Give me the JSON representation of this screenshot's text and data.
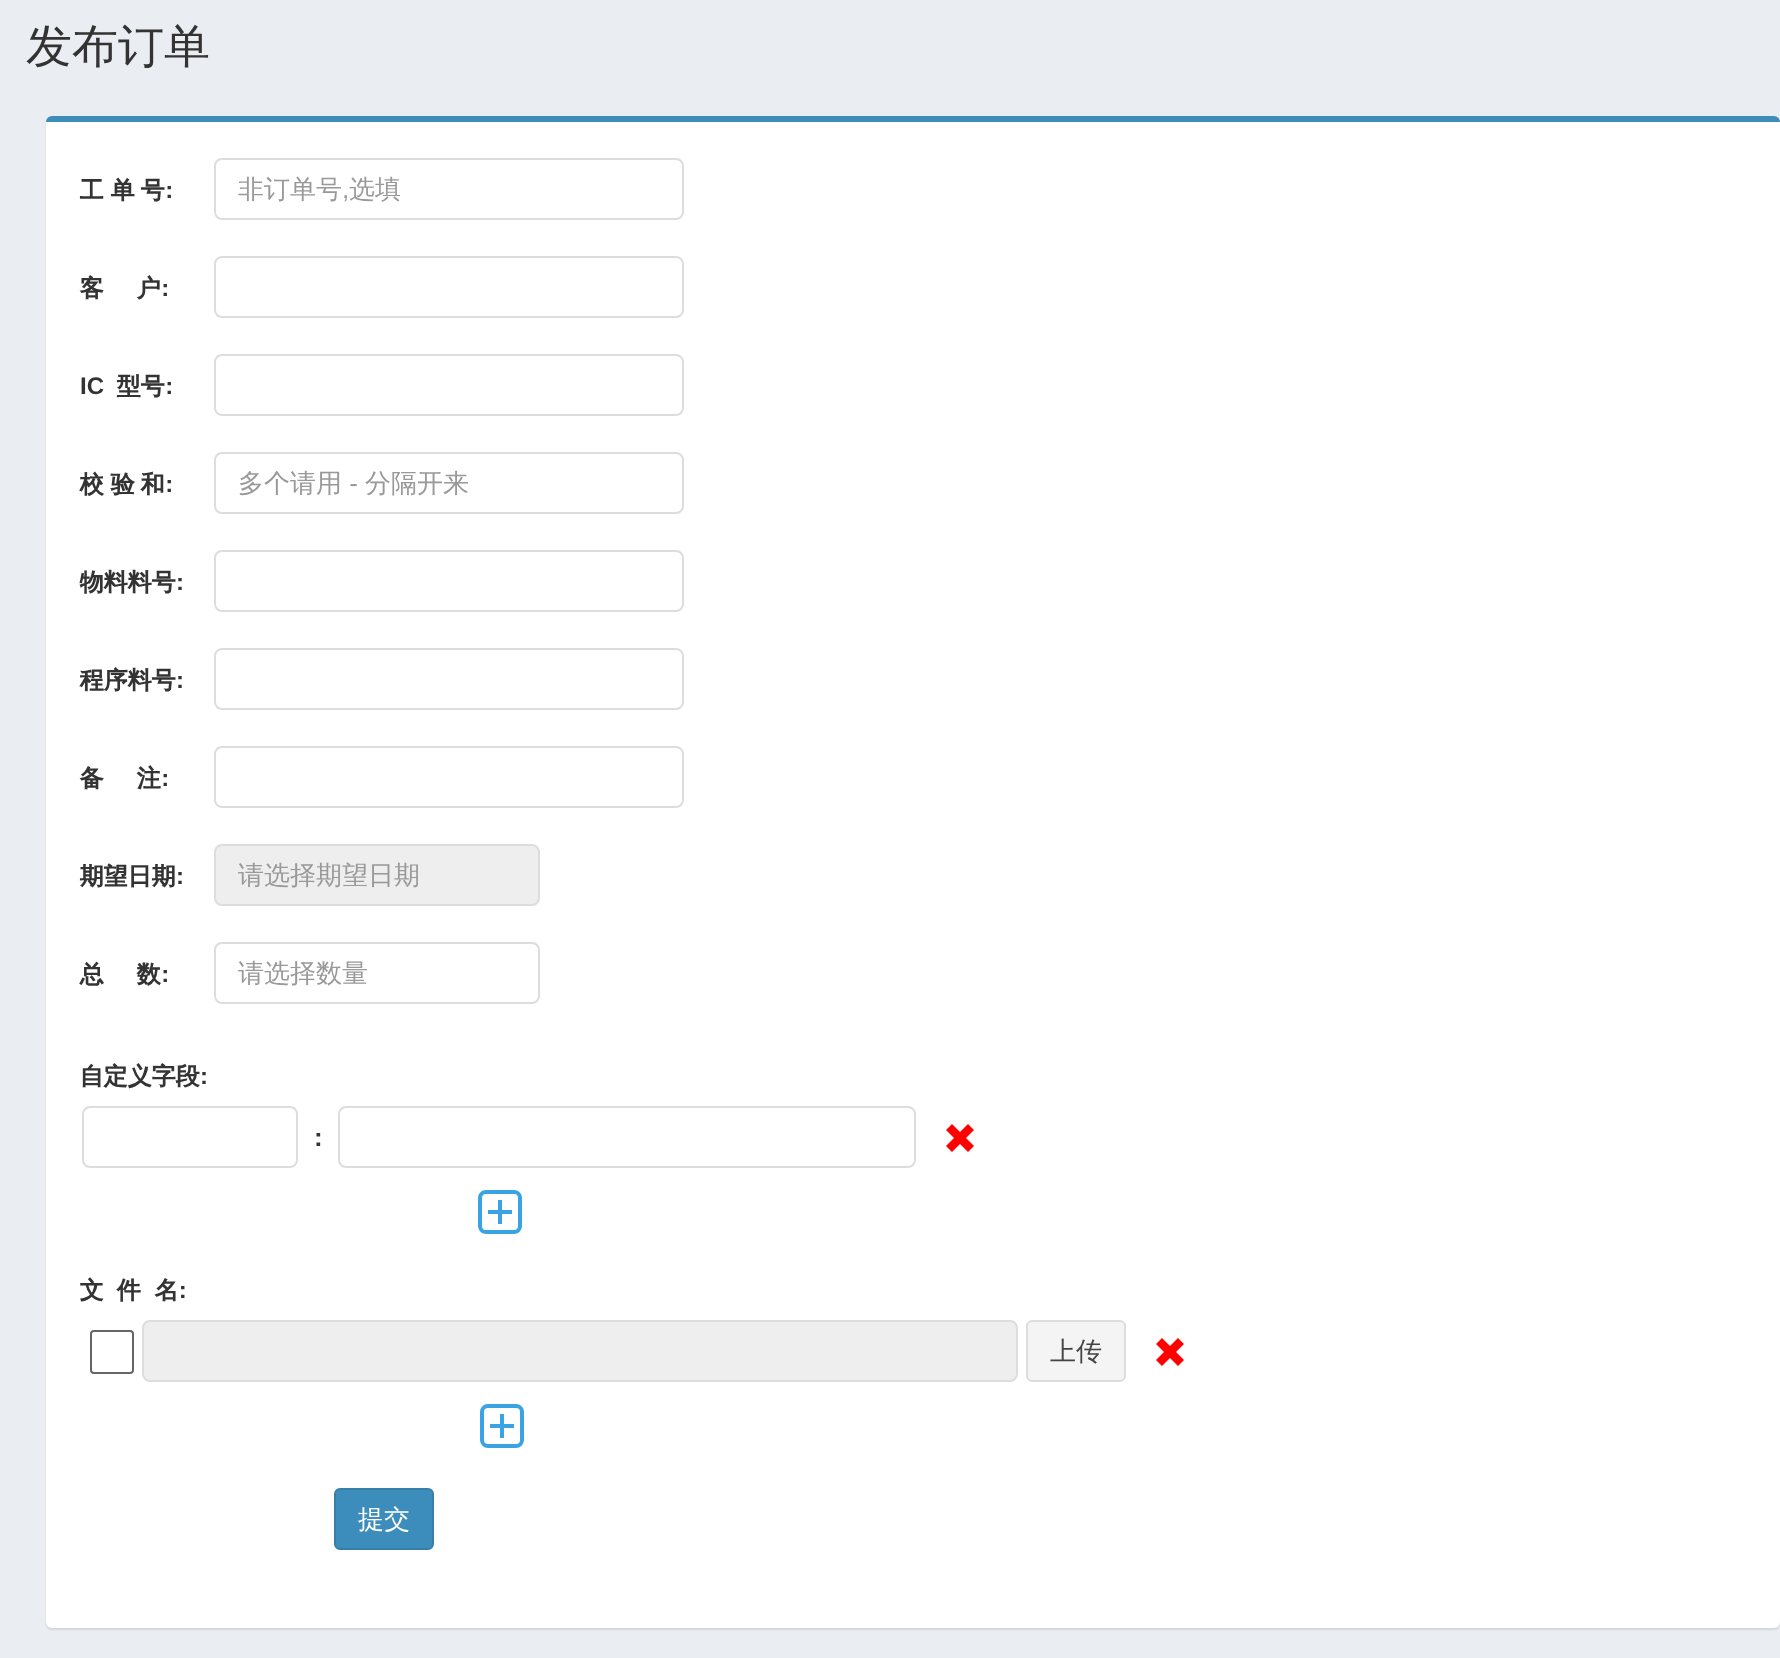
{
  "page": {
    "title": "发布订单"
  },
  "fields": [
    {
      "label": "工 单 号:",
      "placeholder": "非订单号,选填",
      "kind": "wide",
      "disabled": false
    },
    {
      "label": "客     户:",
      "kind": "wide",
      "disabled": false
    },
    {
      "label": "IC  型号:",
      "kind": "wide",
      "disabled": false
    },
    {
      "label": "校 验 和:",
      "placeholder": "多个请用 - 分隔开来",
      "kind": "wide",
      "disabled": false
    },
    {
      "label": "物料料号:",
      "kind": "wide",
      "disabled": false
    },
    {
      "label": "程序料号:",
      "kind": "wide",
      "disabled": false
    },
    {
      "label": "备     注:",
      "kind": "wide",
      "disabled": false
    },
    {
      "label": "期望日期:",
      "placeholder": "请选择期望日期",
      "kind": "narrow",
      "disabled": true
    },
    {
      "label": "总     数:",
      "placeholder": "请选择数量",
      "kind": "narrow",
      "disabled": false
    }
  ],
  "custom_fields": {
    "label": "自定义字段:",
    "rows": [
      {
        "separator": ":"
      }
    ]
  },
  "files": {
    "label": "文  件  名:",
    "rows": [
      {
        "checked": false,
        "button": "上传"
      }
    ]
  },
  "submit": "提交"
}
